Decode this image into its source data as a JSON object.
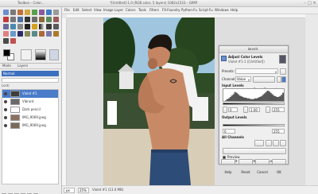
{
  "app": {
    "window_title": "*[Untitled]-1.0 (RGB color, 5 layers) 1082x1533 – GIMP",
    "toolbox_title": "Toolbox – Color..."
  },
  "menubar": {
    "items": [
      "File",
      "Edit",
      "Select",
      "View",
      "Image",
      "Layer",
      "Colors",
      "Tools",
      "Filters",
      "FX-Foundry",
      "Python-Fu",
      "Script-Fu",
      "Windows",
      "Help"
    ]
  },
  "layers_panel": {
    "tab_label": "Mode",
    "tab_label_2": "Layers",
    "mode_label": "Normal",
    "lock_label": "Lock:",
    "layers": [
      {
        "name": "Violet #1",
        "selected": true
      },
      {
        "name": "Vibrant",
        "selected": false
      },
      {
        "name": "Dark pencil",
        "selected": false
      },
      {
        "name": "IMG_9069.jpeg",
        "selected": false
      },
      {
        "name": "IMG_9069.jpeg",
        "selected": false
      }
    ]
  },
  "statusbar": {
    "unit": "px",
    "zoom": "25%",
    "info": "Violet #1 (13.0 MB)"
  },
  "levels_dialog": {
    "title": "Levels",
    "heading": "Adjust Color Levels",
    "subheading": "Violet #1-1 ([Untitled])",
    "presets_label": "Presets:",
    "channel_label": "Channel:",
    "channel_value": "Value",
    "reset_channel_label": "Reset Channel",
    "input_levels_label": "Input Levels",
    "input_low": "0",
    "input_gamma": "1.00",
    "input_high": "255",
    "output_levels_label": "Output Levels",
    "output_low": "0",
    "output_high": "255",
    "all_channels_label": "All Channels",
    "auto_label": "Auto",
    "edit_curves_label": "Edit these Settings as Curves",
    "preview_label": "Preview",
    "help_label": "Help",
    "reset_label": "Reset",
    "cancel_label": "Cancel",
    "ok_label": "OK",
    "histogram": [
      2,
      3,
      5,
      6,
      8,
      10,
      12,
      15,
      14,
      12,
      10,
      9,
      8,
      7,
      7,
      6,
      6,
      5,
      5,
      5,
      6,
      6,
      7,
      8,
      9,
      11,
      13,
      15,
      17,
      16,
      14,
      12,
      10,
      9,
      8,
      8,
      9,
      11,
      14,
      16
    ]
  }
}
